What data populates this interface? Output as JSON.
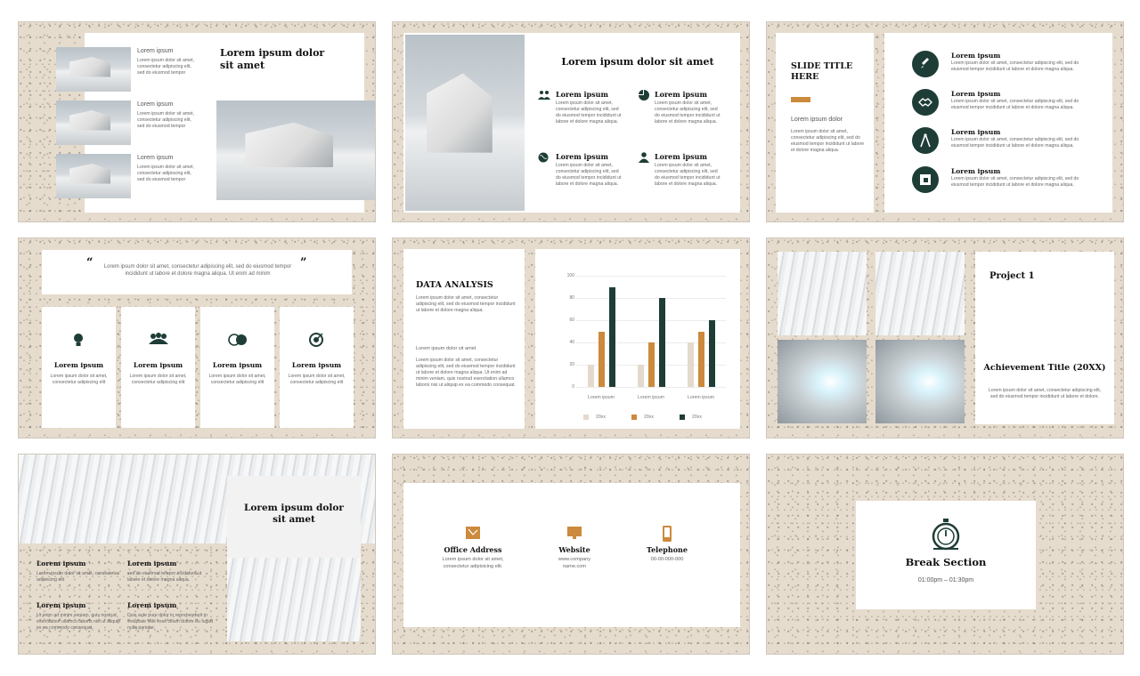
{
  "colors": {
    "accent_orange": "#cc8a3c",
    "dark_green": "#1e3d36",
    "beige_bar": "#e4d9cc",
    "card_white": "#ffffff",
    "terrazzo_bg": "#e6dccd"
  },
  "slide1": {
    "title": "Lorem ipsum dolor sit amet",
    "items": [
      {
        "heading": "Lorem ipsum",
        "text": "Lorem ipsum dolor sit amet, consectetur adipiscing elit, sed do eiusmod tempor"
      },
      {
        "heading": "Lorem ipsum",
        "text": "Lorem ipsum dolor sit amet, consectetur adipiscing elit, sed do eiusmod tempor"
      },
      {
        "heading": "Lorem ipsum",
        "text": "Lorem ipsum dolor sit amet, consectetur adipiscing elit, sed do eiusmod tempor"
      }
    ]
  },
  "slide2": {
    "title": "Lorem ipsum dolor sit amet",
    "items": [
      {
        "icon": "people-icon",
        "heading": "Lorem ipsum",
        "text": "Lorem ipsum dolor sit amet, consectetur adipiscing elit, sed do eiusmod tempor incididunt ut labore et dolore magna aliqua."
      },
      {
        "icon": "pie-chart-icon",
        "heading": "Lorem ipsum",
        "text": "Lorem ipsum dolor sit amet, consectetur adipiscing elit, sed do eiusmod tempor incididunt ut labore et dolore magna aliqua."
      },
      {
        "icon": "globe-icon",
        "heading": "Lorem ipsum",
        "text": "Lorem ipsum dolor sit amet, consectetur adipiscing elit, sed do eiusmod tempor incididunt ut labore et dolore magna aliqua."
      },
      {
        "icon": "user-icon",
        "heading": "Lorem ipsum",
        "text": "Lorem ipsum dolor sit amet, consectetur adipiscing elit, sed do eiusmod tempor incididunt ut labore et dolore magna aliqua."
      }
    ]
  },
  "slide3": {
    "title": "SLIDE TITLE HERE",
    "subtitle": "Lorem ipsum dolor",
    "text": "Lorem ipsum dolor sit amet, consectetur adipiscing elit, sed do eiusmod tempor incididunt ut labore et dolore magna aliqua.",
    "items": [
      {
        "icon": "rocket-icon",
        "heading": "Lorem ipsum",
        "text": "Lorem ipsum dolor sit amet, consectetur adipiscing elit, sed do eiusmod tempor incididunt ut labore et dolore magna aliqua."
      },
      {
        "icon": "handshake-icon",
        "heading": "Lorem ipsum",
        "text": "Lorem ipsum dolor sit amet, consectetur adipiscing elit, sed do eiusmod tempor incididunt ut labore et dolore magna aliqua."
      },
      {
        "icon": "compass-icon",
        "heading": "Lorem ipsum",
        "text": "Lorem ipsum dolor sit amet, consectetur adipiscing elit, sed do eiusmod tempor incididunt ut labore et dolore magna aliqua."
      },
      {
        "icon": "puzzle-icon",
        "heading": "Lorem ipsum",
        "text": "Lorem ipsum dolor sit amet, consectetur adipiscing elit, sed do eiusmod tempor incididunt ut labore et dolore magna aliqua."
      }
    ]
  },
  "slide4": {
    "quote": "Lorem ipsum dolor sit amet, consectetur adipiscing elit, sed do eiusmod tempor incididunt ut labore et dolore magna aliqua. Ut enim ad minim",
    "quote_open": "“",
    "quote_close": "”",
    "cards": [
      {
        "icon": "lightbulb-icon",
        "heading": "Lorem ipsum",
        "text": "Lorem ipsum dolor sit amet, consectetur adipiscing elit"
      },
      {
        "icon": "team-icon",
        "heading": "Lorem ipsum",
        "text": "Lorem ipsum dolor sit amet, consectetur adipiscing elit"
      },
      {
        "icon": "money-globe-icon",
        "heading": "Lorem ipsum",
        "text": "Lorem ipsum dolor sit amet, consectetur adipiscing elit"
      },
      {
        "icon": "target-icon",
        "heading": "Lorem ipsum",
        "text": "Lorem ipsum dolor sit amet, consectetur adipiscing elit"
      }
    ]
  },
  "slide5": {
    "title": "DATA ANALYSIS",
    "text1": "Lorem ipsum dolor sit amet, consectetur adipiscing elit, sed do eiusmod tempor incididunt ut labore et dolore magna aliqua.",
    "subheading": "Lorem ipsum dolor sit amet",
    "text2": "Lorem ipsum dolor sit amet, consectetur adipiscing elit, sed do eiusmod tempor incididunt ut labore et dolore magna aliqua. Ut enim ad minim veniam, quis nostrud exercitation ullamco laboris nisi ut aliquip ex ea commodo consequat."
  },
  "chart_data": {
    "type": "bar",
    "categories": [
      "Lorem ipsum",
      "Lorem ipsum",
      "Lorem ipsum"
    ],
    "series": [
      {
        "name": "20xx",
        "values": [
          20,
          20,
          40
        ],
        "color": "#e4d9cc"
      },
      {
        "name": "20xx",
        "values": [
          50,
          40,
          50
        ],
        "color": "#cc8a3c"
      },
      {
        "name": "20xx",
        "values": [
          90,
          80,
          60
        ],
        "color": "#1e3d36"
      }
    ],
    "yticks": [
      "0",
      "20",
      "40",
      "60",
      "80",
      "100"
    ],
    "ylim": [
      0,
      100
    ],
    "grid": true,
    "legend": "bottom"
  },
  "slide6": {
    "project": "Project 1",
    "title": "Achievement Title (20XX)",
    "text": "Lorem ipsum dolor sit amet, consectetur adipiscing elit, sed do eiusmod tempor incididunt ut labore et dolore."
  },
  "slide7": {
    "title": "Lorem ipsum dolor sit amet",
    "items": [
      {
        "heading": "Lorem ipsum",
        "text": "Lorem ipsum dolor sit amet, consectetur adipiscing elit"
      },
      {
        "heading": "Lorem ipsum",
        "text": "sed do eiusmod tempor incididunt ut labore et dolore magna aliqua."
      },
      {
        "heading": "Lorem ipsum",
        "text": "Ut enim ad minim veniam, quis nostrud exercitation ullamco laboris nisi ut aliquip ex ea commodo consequat."
      },
      {
        "heading": "Lorem ipsum",
        "text": "Duis aute irure dolor in reprehenderit in voluptate velit esse cillum dolore eu fugiat nulla pariatur."
      }
    ]
  },
  "slide8": {
    "items": [
      {
        "icon": "map-icon",
        "heading": "Office Address",
        "text": "Lorem ipsum dolor sit amet, consectetur adipisicing elit."
      },
      {
        "icon": "monitor-icon",
        "heading": "Website",
        "text": "www.company name.com"
      },
      {
        "icon": "phone-icon",
        "heading": "Telephone",
        "text": "00-00-000-000"
      }
    ]
  },
  "slide9": {
    "title": "Break Section",
    "time": "01:00pm – 01:30pm"
  }
}
